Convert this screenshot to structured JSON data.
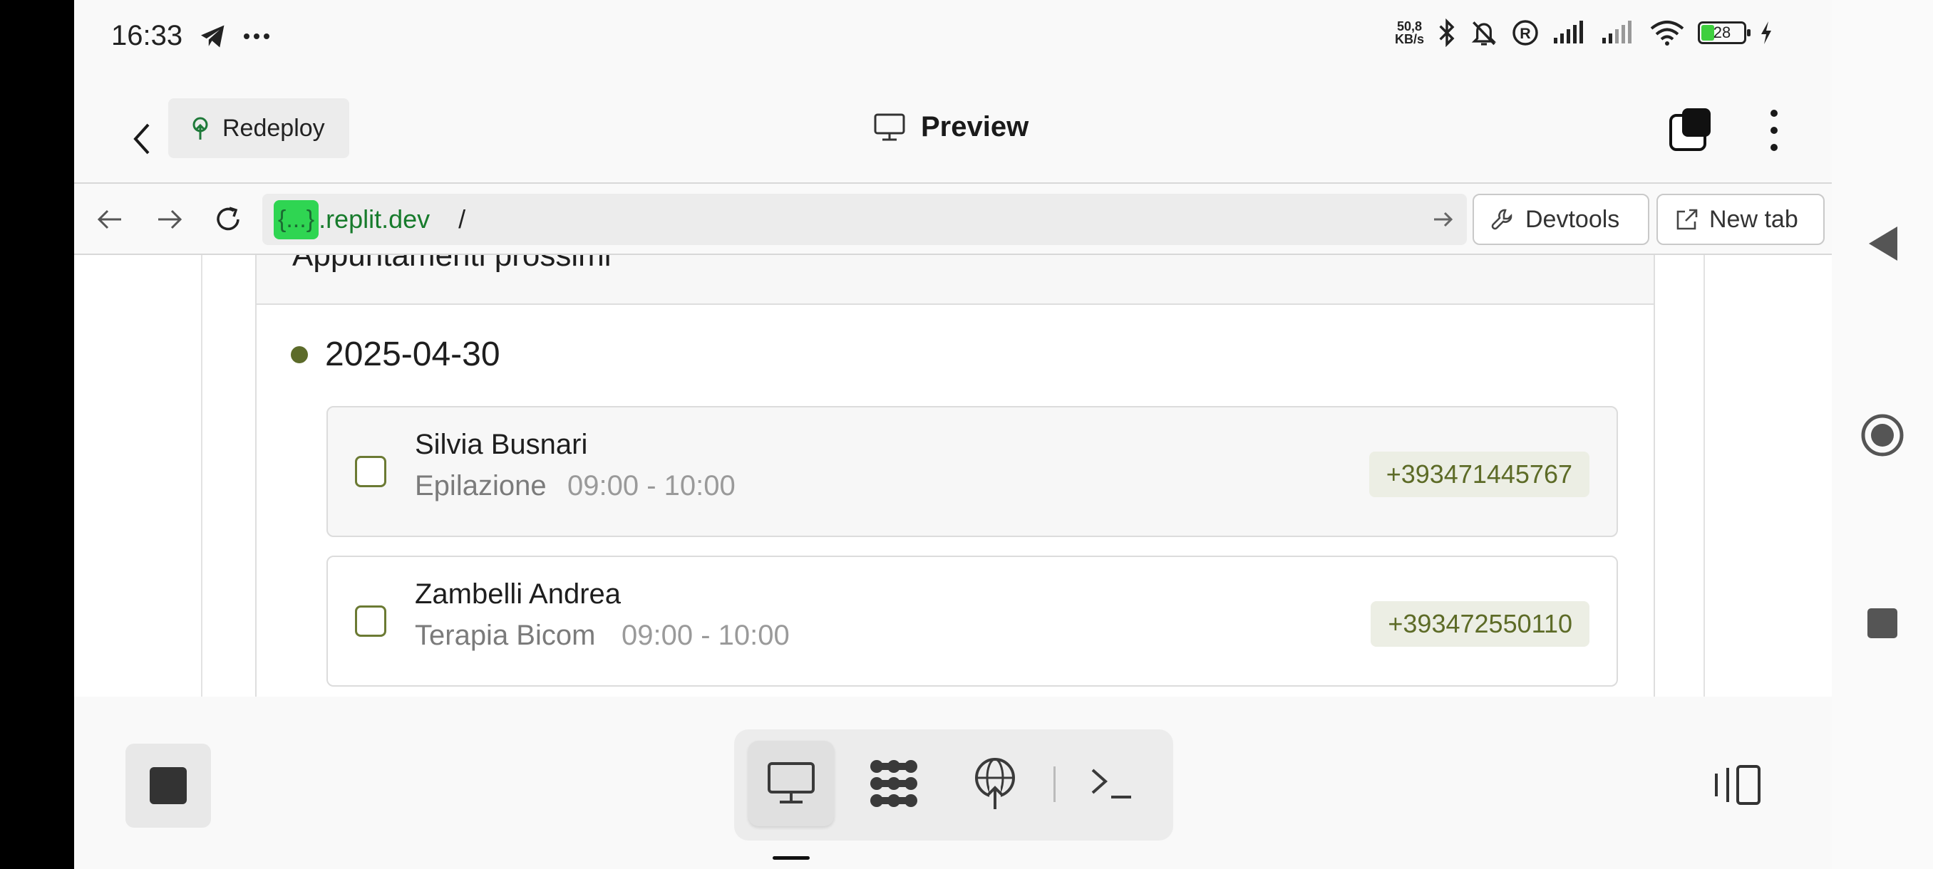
{
  "status_bar": {
    "time": "16:33",
    "icons": [
      "telegram-icon",
      "more-dots-icon",
      "bluetooth-icon",
      "bell-off-icon",
      "registered-icon",
      "signal-icon",
      "signal-icon",
      "wifi-icon",
      "battery-icon",
      "charging-icon"
    ],
    "speed_top": "50,8",
    "speed_bottom": "KB/s",
    "battery": "28"
  },
  "header": {
    "redeploy_label": "Redeploy",
    "title": "Preview"
  },
  "url_bar": {
    "masked": "{...}",
    "domain": ".replit.dev",
    "path": "/",
    "devtools_label": "Devtools",
    "new_tab_label": "New tab"
  },
  "page": {
    "section_title": "Appuntamenti prossimi",
    "date": "2025-04-30",
    "appointments": [
      {
        "name": "Silvia Busnari",
        "service": "Epilazione",
        "time": "09:00 - 10:00",
        "phone": "+393471445767"
      },
      {
        "name": "Zambelli Andrea",
        "service": "Terapia Bicom",
        "time": "09:00 - 10:00",
        "phone": "+393472550110"
      }
    ]
  },
  "colors": {
    "accent_olive": "#5c6b2a",
    "url_green": "#2fd552",
    "phone_bg": "#eceee4"
  }
}
